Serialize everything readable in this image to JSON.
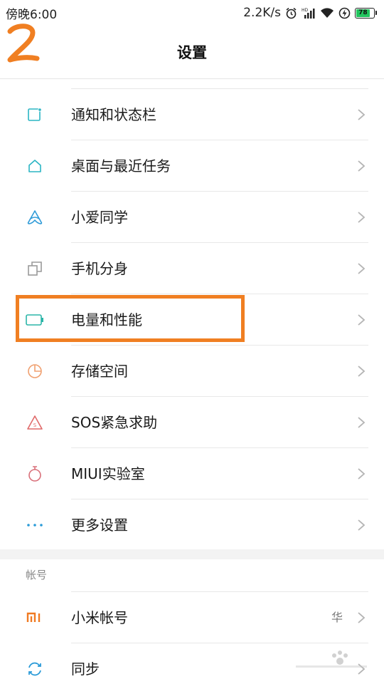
{
  "status_bar": {
    "time": "傍晚6:00",
    "net_speed": "2.2K/s",
    "battery_level": "78",
    "icons": [
      "alarm-icon",
      "signal-icon",
      "wifi-icon",
      "charging-icon",
      "battery-icon"
    ],
    "battery_color": "#22c55e"
  },
  "header": {
    "title": "设置"
  },
  "main": {
    "items": [
      {
        "label": "通知和状态栏",
        "icon": "notification-icon",
        "icon_color": "#2bb5c4"
      },
      {
        "label": "桌面与最近任务",
        "icon": "home-icon",
        "icon_color": "#2bb5c4"
      },
      {
        "label": "小爱同学",
        "icon": "xiaoai-icon",
        "icon_color": "#2f9bd8"
      },
      {
        "label": "手机分身",
        "icon": "second-space-icon",
        "icon_color": "#9a9a9a"
      },
      {
        "label": "电量和性能",
        "icon": "battery-icon",
        "icon_color": "#2bb5a8"
      },
      {
        "label": "存储空间",
        "icon": "storage-icon",
        "icon_color": "#f0a070"
      },
      {
        "label": "SOS紧急求助",
        "icon": "sos-icon",
        "icon_color": "#e06a6a"
      },
      {
        "label": "MIUI实验室",
        "icon": "lab-icon",
        "icon_color": "#d9707a"
      },
      {
        "label": "更多设置",
        "icon": "more-icon",
        "icon_color": "#2b9bd8"
      }
    ]
  },
  "account_section": {
    "title": "帐号",
    "items": [
      {
        "label": "小米帐号",
        "value": "华",
        "icon": "mi-icon",
        "icon_color": "#f07a22"
      },
      {
        "label": "同步",
        "icon": "sync-icon",
        "icon_color": "#2b9bd8"
      }
    ]
  },
  "annotation": {
    "step_number_color": "#f07f22",
    "highlight_color": "#f07f22"
  }
}
